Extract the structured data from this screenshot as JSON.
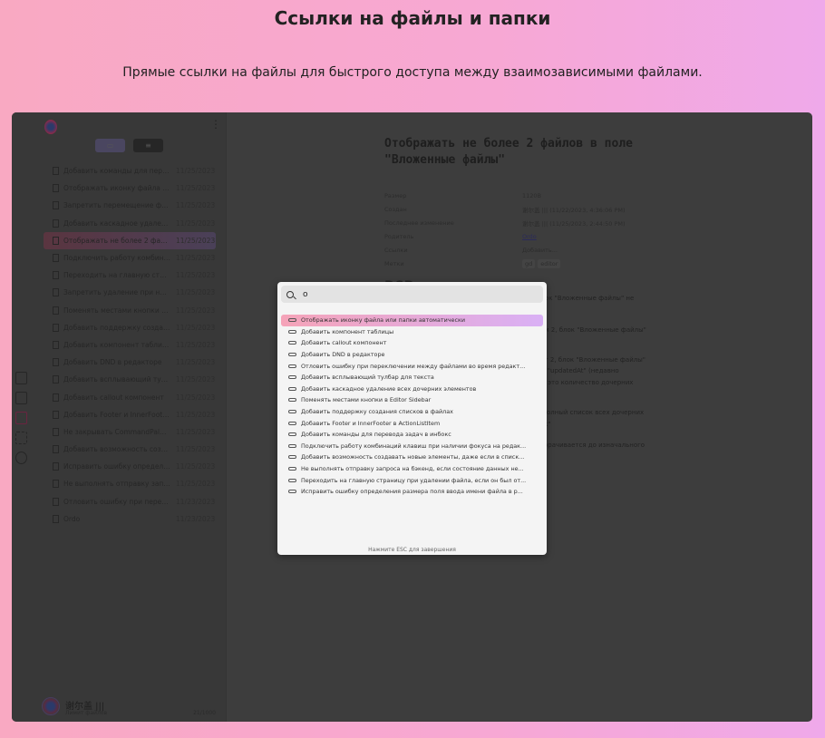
{
  "header": {
    "title": "Ссылки на файлы и папки",
    "subtitle": "Прямые ссылки на файлы для быстрого доступа между взаимозависимыми файлами."
  },
  "sidebar": {
    "files": [
      {
        "name": "Добавить команды для перев...",
        "date": "11/25/2023"
      },
      {
        "name": "Отображать иконку файла или...",
        "date": "11/25/2023"
      },
      {
        "name": "Запретить перемещение файл...",
        "date": "11/25/2023"
      },
      {
        "name": "Добавить каскадное удалени...",
        "date": "11/25/2023"
      },
      {
        "name": "Отображать не более 2 файло...",
        "date": "11/25/2023",
        "selected": true
      },
      {
        "name": "Подключить работу комбинац...",
        "date": "11/25/2023"
      },
      {
        "name": "Переходить на главную стран...",
        "date": "11/25/2023"
      },
      {
        "name": "Запретить удаление при нали...",
        "date": "11/25/2023"
      },
      {
        "name": "Поменять местами кнопки в E...",
        "date": "11/25/2023"
      },
      {
        "name": "Добавить поддержку создани...",
        "date": "11/25/2023"
      },
      {
        "name": "Добавить компонент таблицы",
        "date": "11/25/2023"
      },
      {
        "name": "Добавить DND в редакторе",
        "date": "11/25/2023"
      },
      {
        "name": "Добавить всплывающий тулба...",
        "date": "11/25/2023"
      },
      {
        "name": "Добавить callout компонент",
        "date": "11/25/2023"
      },
      {
        "name": "Добавить Footer и InnerFooter ...",
        "date": "11/25/2023"
      },
      {
        "name": "Не закрывать CommandPalette...",
        "date": "11/25/2023"
      },
      {
        "name": "Добавить возможность создав...",
        "date": "11/25/2023"
      },
      {
        "name": "Исправить ошибку определен...",
        "date": "11/25/2023"
      },
      {
        "name": "Не выполнять отправку запро...",
        "date": "11/25/2023"
      },
      {
        "name": "Отловить ошибку при перекл...",
        "date": "11/23/2023"
      },
      {
        "name": "Ordo",
        "date": "11/23/2023"
      }
    ],
    "user": {
      "name": "谢尔盖 |||",
      "limit_label": "Лимит файлов",
      "count": "21/1000"
    }
  },
  "document": {
    "title": "Отображать не более 2 файлов в поле \"Вложенные файлы\"",
    "props": [
      {
        "key": "Размер",
        "value": "1120B"
      },
      {
        "key": "Создан",
        "value": "谢尔盖 ||| (11/22/2023, 4:36:06 PM)"
      },
      {
        "key": "Последнее изменение",
        "value": "谢尔盖 ||| (11/25/2023, 2:44:50 PM)"
      },
      {
        "key": "Родитель",
        "value": "Ordo"
      },
      {
        "key": "Ссылки",
        "value": "Добавить..."
      }
    ],
    "tags_label": "Метки",
    "tags": [
      "gd",
      "editor"
    ],
    "heading": "DSD",
    "fragments": [
      "блок \"Вложенные файлы\" не",
      "или 2, блок \"Вложенные файлы\"",
      "ает 2, блок \"Вложенные файлы\"",
      "ом \"updatedAt\" (недавно",
      "N - это количество дочерних",
      "я полный список всех дочерних",
      "сок\"",
      "сворачивается до изначального"
    ]
  },
  "palette": {
    "query": "o",
    "hint": "Нажмите ESC для завершения",
    "results": [
      "Отображать иконку файла или папки автоматически",
      "Добавить компонент таблицы",
      "Добавить callout компонент",
      "Добавить DND в редакторе",
      "Отловить ошибку при переключении между файлами во время редакт...",
      "Добавить всплывающий тулбар для текста",
      "Добавить каскадное удаление всех дочерних элементов",
      "Поменять местами кнопки в Editor Sidebar",
      "Добавить поддержку создания списков в файлах",
      "Добавить Footer и InnerFooter в ActionListItem",
      "Добавить команды для перевода задач в инбокс",
      "Подключить работу комбинаций клавиш при наличии фокуса на редак...",
      "Добавить возможность создавать новые элементы, даже если в списк...",
      "Не выполнять отправку запроса на бэкенд, если состояние данных не...",
      "Переходить на главную страницу при удалении файла, если он был от...",
      "Исправить ошибку определения размера поля ввода имени файла в р..."
    ]
  }
}
